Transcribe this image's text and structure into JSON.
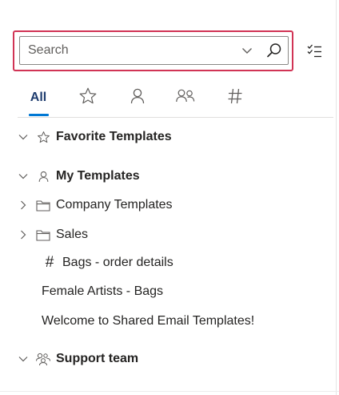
{
  "search": {
    "placeholder": "Search"
  },
  "tabs": [
    {
      "label": "All",
      "icon": "all"
    },
    {
      "label": "",
      "icon": "star-icon"
    },
    {
      "label": "",
      "icon": "person-icon"
    },
    {
      "label": "",
      "icon": "people-icon"
    },
    {
      "label": "",
      "icon": "hash-icon"
    }
  ],
  "tree": {
    "favorites": {
      "label": "Favorite Templates",
      "icon": "star-icon"
    },
    "my_templates": {
      "label": "My Templates",
      "icon": "person-icon",
      "folders": [
        {
          "label": "Company Templates",
          "icon": "folder-icon"
        },
        {
          "label": "Sales",
          "icon": "folder-icon"
        }
      ],
      "items": [
        {
          "label": "Bags - order details",
          "icon": "hash-icon",
          "hash": "#"
        },
        {
          "label": "Female Artists - Bags"
        },
        {
          "label": "Welcome to Shared Email Templates!"
        }
      ]
    },
    "support_team": {
      "label": "Support team",
      "icon": "team-icon"
    }
  },
  "colors": {
    "focus_border": "#d13455",
    "accent": "#0078d4",
    "tab_active_text": "#1e3c6e"
  }
}
